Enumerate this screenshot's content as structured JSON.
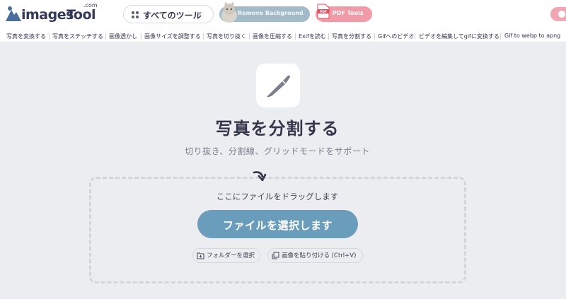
{
  "header": {
    "logo_images": "images",
    "logo_tool": "Tool",
    "logo_com": ".com",
    "all_tools_label": "すべてのツール",
    "remove_bg_label": "Remove Background",
    "pdf_tools_label": "PDF Tools",
    "pdf_icon_text": "PDF"
  },
  "subnav": {
    "items": [
      "写真を変換する",
      "写真をステッチする",
      "画像透かし",
      "画像サイズを調整する",
      "写真を切り抜く",
      "画像を圧縮する",
      "Exifを読む",
      "写真を分割する",
      "Gifへのビデオ",
      "ビデオを編集してgifに変換する",
      "Gif to webp to apng"
    ]
  },
  "main": {
    "title": "写真を分割する",
    "subtitle": "切り抜き、分割線、グリッドモードをサポート",
    "drag_text": "ここにファイルをドラッグします",
    "choose_file_label": "ファイルを選択します",
    "folder_label": "フォルダーを選択",
    "paste_label": "画像を貼り付ける (Ctrl+V)"
  },
  "colors": {
    "primary_button": "#6a9cbc",
    "remove_bg_pill": "#a3bac8",
    "pdf_pill": "#f09ba7",
    "background": "#ecedf0",
    "text_dark": "#34374c"
  },
  "icons": {
    "logo": "mountain-logo-icon",
    "all_tools": "grid-dots-icon",
    "dropdown": "caret-down-icon",
    "remove_bg": "cat-photo-icon",
    "pdf": "pdf-file-icon",
    "tool": "knife-icon",
    "drop_hint": "curved-arrow-icon",
    "folder": "folder-plus-icon",
    "paste": "clipboard-icon"
  }
}
